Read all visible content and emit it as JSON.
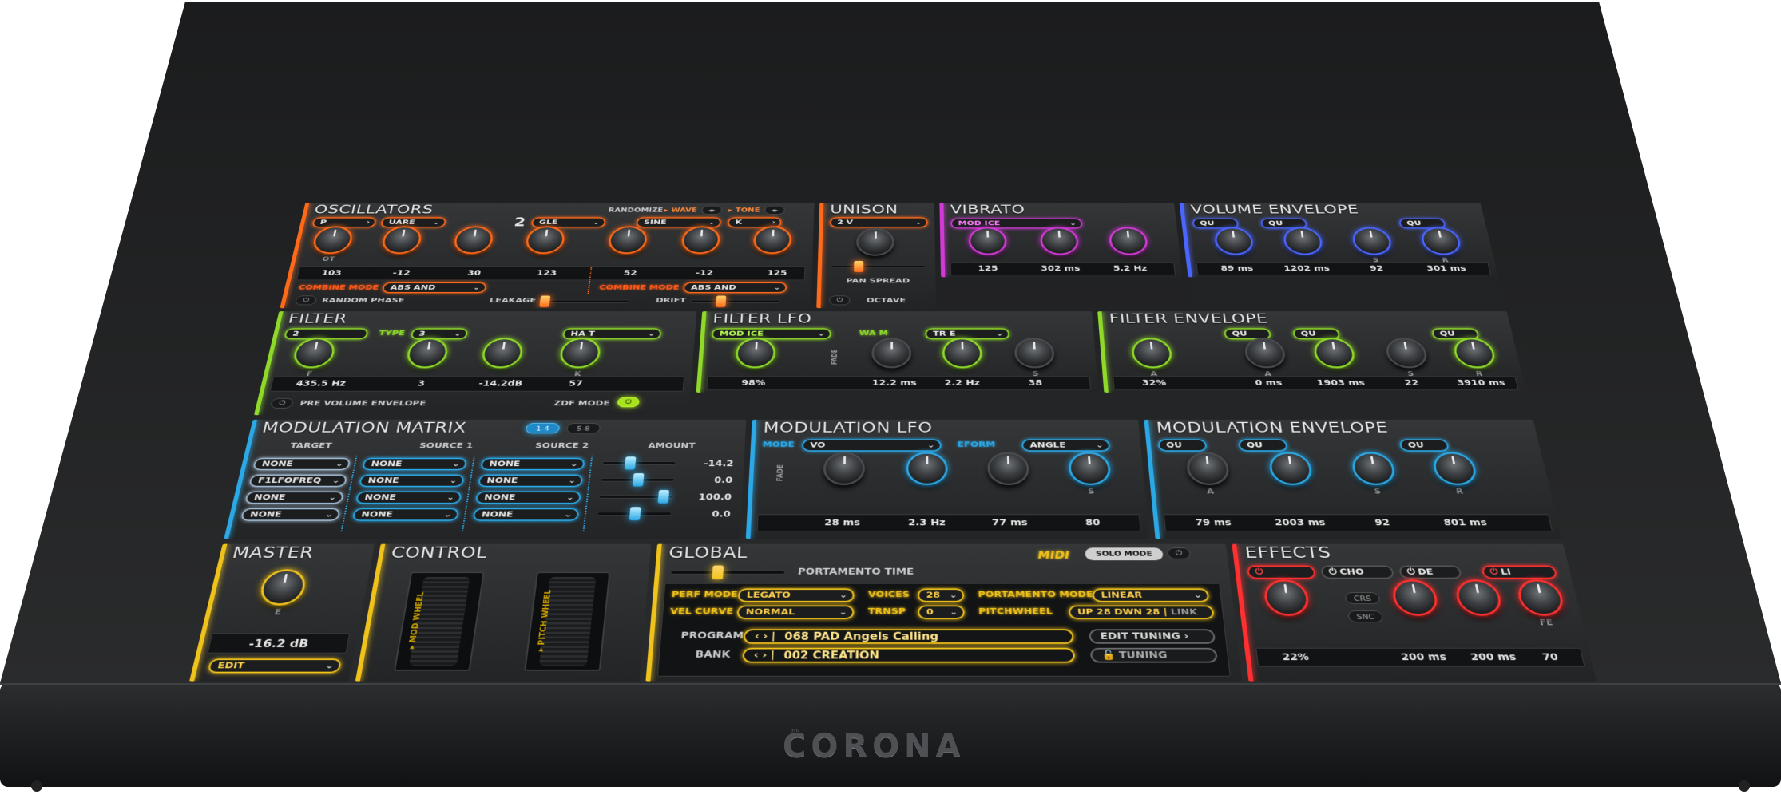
{
  "brand": "CORONA",
  "colors": {
    "osc": "#ff6a1a",
    "unison": "#ff6a1a",
    "vibrato": "#d23ad6",
    "volenv": "#4b66ff",
    "filter": "#8fd92a",
    "mod": "#2ba8e6",
    "master": "#f0c21c",
    "effects": "#ff3030"
  },
  "oscillators": {
    "title": "OSCILLATORS",
    "randomize": "RANDOMIZE",
    "wave": "▸ WAVE",
    "tone": "▸ TONE",
    "values": [
      "103",
      "-12",
      "30",
      "123",
      "52",
      "-12",
      "125"
    ],
    "labels": [
      "OT",
      "",
      "",
      "",
      "",
      "",
      ""
    ],
    "modes": [
      "P",
      "UARE",
      "2",
      "GLE",
      "SINE",
      "K"
    ],
    "combine": "COMBINE MODE",
    "combine_a": "ABS AND",
    "combine_b": "ABS AND",
    "random_phase": "RANDOM PHASE",
    "leakage": "LEAKAGE",
    "drift": "DRIFT"
  },
  "unison": {
    "title": "UNISON",
    "mode": "2 V",
    "pan_spread": "PAN SPREAD",
    "octave": "OCTAVE"
  },
  "vibrato": {
    "title": "VIBRATO",
    "mode": "MOD  ICE",
    "values": [
      "125",
      "302 ms",
      "5.2 Hz"
    ]
  },
  "volume_envelope": {
    "title": "VOLUME ENVELOPE",
    "quant": "QU",
    "values": [
      "89 ms",
      "1202 ms",
      "92",
      "301 ms"
    ],
    "labels": [
      "",
      "",
      "S",
      "R"
    ]
  },
  "filter": {
    "title": "FILTER",
    "type": "TYPE",
    "slope": "2",
    "kind": "HA  T",
    "mode": "3",
    "values": [
      "435.5 Hz",
      "3",
      "-14.2dB",
      "57"
    ],
    "labels": [
      "F",
      "",
      "",
      "K"
    ],
    "pre": "PRE VOLUME ENVELOPE",
    "zdf": "ZDF MODE"
  },
  "filter_lfo": {
    "title": "FILTER LFO",
    "mode": "MOD  ICE",
    "wave": "WA  M",
    "tr": "TR  E",
    "fade": "FADE",
    "values": [
      "98%",
      "12.2 ms",
      "2.2 Hz",
      "38"
    ],
    "labels": [
      "",
      "",
      "",
      "S"
    ]
  },
  "filter_envelope": {
    "title": "FILTER ENVELOPE",
    "quant": "QU",
    "values": [
      "32%",
      "0 ms",
      "1903 ms",
      "22",
      "3910 ms"
    ],
    "labels": [
      "A",
      "A",
      "",
      "S",
      "R"
    ]
  },
  "mod_matrix": {
    "title": "MODULATION MATRIX",
    "page1": "1-4",
    "page2": "5-8",
    "headers": [
      "TARGET",
      "SOURCE 1",
      "SOURCE 2",
      "AMOUNT"
    ],
    "rows": [
      {
        "target": "NONE",
        "s1": "NONE",
        "s2": "NONE",
        "amount": "-14.2"
      },
      {
        "target": "F1LFOFREQ",
        "s1": "NONE",
        "s2": "NONE",
        "amount": "0.0"
      },
      {
        "target": "NONE",
        "s1": "NONE",
        "s2": "NONE",
        "amount": "100.0"
      },
      {
        "target": "NONE",
        "s1": "NONE",
        "s2": "NONE",
        "amount": "0.0"
      }
    ],
    "amount_levels": [
      0.35,
      0.5,
      0.92,
      0.5
    ]
  },
  "mod_lfo": {
    "title": "MODULATION LFO",
    "mode": "MODE",
    "v": "VO",
    "wave": "EFORM",
    "angle": "ANGLE",
    "fade": "FADE",
    "values": [
      "28 ms",
      "2.3 Hz",
      "77 ms",
      "80"
    ],
    "labels": [
      "",
      "",
      "",
      "S"
    ]
  },
  "mod_envelope": {
    "title": "MODULATION ENVELOPE",
    "quant": "QU",
    "values": [
      "79 ms",
      "2003 ms",
      "92",
      "801 ms"
    ],
    "labels": [
      "A",
      "",
      "S",
      "R"
    ]
  },
  "master": {
    "title": "MASTER",
    "value": "-16.2 dB",
    "edit": "EDIT",
    "knob_label": "E"
  },
  "control": {
    "title": "CONTROL",
    "mod_wheel": "▸ MOD WHEEL",
    "pitch_wheel": "▸ PITCH WHEEL"
  },
  "global": {
    "title": "GLOBAL",
    "midi": "MIDI",
    "solo": "SOLO MODE",
    "portamento_time": "PORTAMENTO TIME",
    "perf_mode_l": "PERF MODE",
    "perf_mode": "LEGATO",
    "voices_l": "VOICES",
    "voices": "28",
    "porta_mode_l": "PORTAMENTO MODE",
    "porta_mode": "LINEAR",
    "vel_curve_l": "VEL CURVE",
    "vel_curve": "NORMAL",
    "trnsp_l": "TRNSP",
    "trnsp": "0",
    "pitchwheel_l": "PITCHWHEEL",
    "up": "UP 28",
    "dwn": "DWN 28",
    "link": "LINK",
    "program_l": "PROGRAM",
    "program": "068 PAD Angels Calling",
    "bank_l": "BANK",
    "bank": "002 CREATION",
    "edit_tuning": "EDIT TUNING ›",
    "tuning": "TUNING"
  },
  "effects": {
    "title": "EFFECTS",
    "tabs": [
      "",
      "CHO",
      "DE",
      "LI"
    ],
    "crs": "CRS",
    "snc": "SNC",
    "fe": "FE",
    "values": [
      "22%",
      "200 ms",
      "200 ms",
      "70"
    ]
  }
}
